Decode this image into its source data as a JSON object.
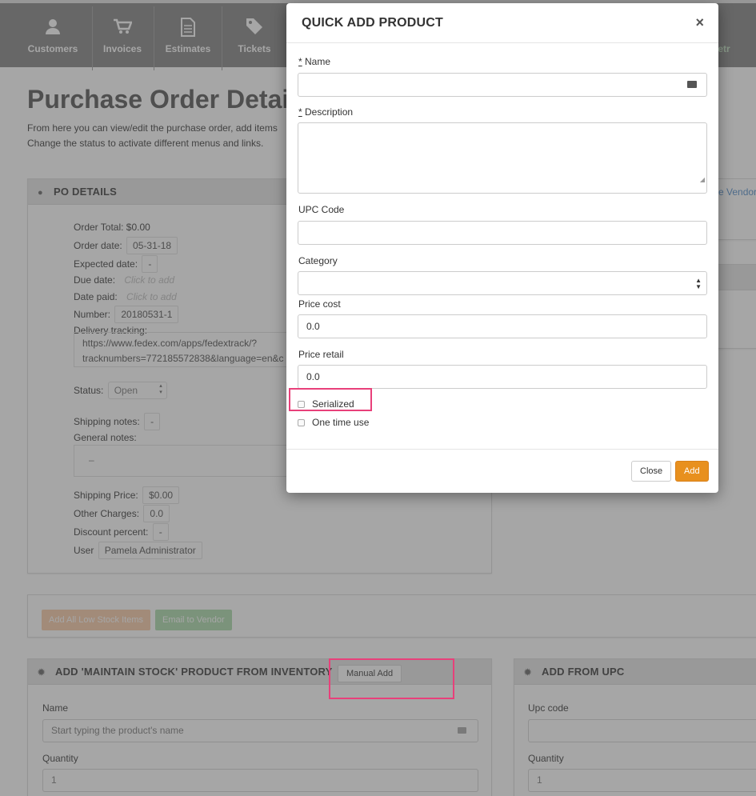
{
  "nav": {
    "items": [
      {
        "label": "Customers",
        "icon": "user-icon"
      },
      {
        "label": "Invoices",
        "icon": "cart-icon"
      },
      {
        "label": "Estimates",
        "icon": "document-icon"
      },
      {
        "label": "Tickets",
        "icon": "tag-icon"
      }
    ],
    "partial_right_label": "etr"
  },
  "page": {
    "title": "Purchase Order Detail",
    "description_line1": "From here you can view/edit the purchase order, add items",
    "description_line2": "Change the status to activate different menus and links."
  },
  "po_details": {
    "heading": "PO DETAILS",
    "order_total": "Order Total: $0.00",
    "order_date_label": "Order date:",
    "order_date": "05-31-18",
    "expected_date_label": "Expected date:",
    "expected_date": "-",
    "due_date_label": "Due date:",
    "due_date_placeholder": "Click to add",
    "date_paid_label": "Date paid:",
    "date_paid_placeholder": "Click to add",
    "number_label": "Number:",
    "number": "20180531-1",
    "delivery_tracking_label": "Delivery tracking:",
    "delivery_tracking_line1": "https://www.fedex.com/apps/fedextrack/?",
    "delivery_tracking_line2": "tracknumbers=772185572838&language=en&c",
    "status_label": "Status:",
    "status": "Open",
    "shipping_notes_label": "Shipping notes:",
    "shipping_notes": "-",
    "general_notes_label": "General notes:",
    "general_notes": "–",
    "shipping_price_label": "Shipping Price:",
    "shipping_price": "$0.00",
    "other_charges_label": "Other Charges:",
    "other_charges": "0.0",
    "discount_percent_label": "Discount percent:",
    "discount_percent": "-",
    "user_label": "User",
    "user": "Pamela Administrator"
  },
  "right_panel": {
    "partial_link": "e Vendor"
  },
  "actions": {
    "add_low_stock": "Add All Low Stock Items",
    "email_vendor": "Email to Vendor",
    "low_stock_color": "#f5c6a5",
    "email_color": "#a9d8a9"
  },
  "add_inventory": {
    "heading": "ADD 'MAINTAIN STOCK' PRODUCT FROM INVENTORY",
    "manual_add": "Manual Add",
    "name_label": "Name",
    "name_placeholder": "Start typing the product's name",
    "quantity_label": "Quantity",
    "quantity": "1"
  },
  "add_upc": {
    "heading": "ADD FROM UPC",
    "upc_label": "Upc code",
    "quantity_label": "Quantity",
    "quantity": "1"
  },
  "modal": {
    "title": "QUICK ADD PRODUCT",
    "close_symbol": "×",
    "name_label": "Name",
    "description_label": "Description",
    "required_mark": "*",
    "upc_label": "UPC Code",
    "category_label": "Category",
    "price_cost_label": "Price cost",
    "price_cost": "0.0",
    "price_retail_label": "Price retail",
    "price_retail": "0.0",
    "serialized_label": "Serialized",
    "serialized_checked": false,
    "one_time_use_label": "One time use",
    "one_time_use_checked": false,
    "close_button": "Close",
    "add_button": "Add",
    "add_color": "#e8901e",
    "highlight_color": "#e8407a"
  }
}
